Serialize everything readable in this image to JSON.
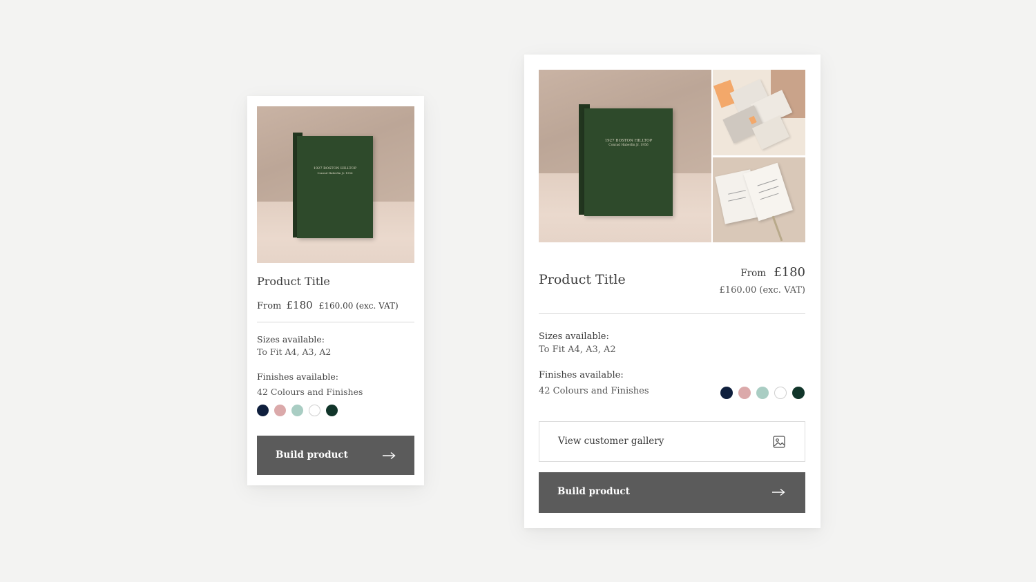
{
  "cards": {
    "small": {
      "title": "Product Title",
      "price_prefix": "From",
      "price": "£180",
      "price_ex_vat": "£160.00 (exc. VAT)",
      "sizes_label": "Sizes available:",
      "sizes_value": "To Fit A4,  A3, A2",
      "finishes_label": "Finishes available:",
      "finishes_value": "42 Colours and Finishes",
      "build_button": "Build product",
      "binder_line1": "1927 BOSTON HILLTOP",
      "binder_line2": "Conrad Haberlin Jr. 1956"
    },
    "large": {
      "title": "Product Title",
      "price_prefix": "From",
      "price": "£180",
      "price_ex_vat": "£160.00 (exc. VAT)",
      "sizes_label": "Sizes available:",
      "sizes_value": "To Fit A4,  A3, A2",
      "finishes_label": "Finishes available:",
      "finishes_value": "42 Colours and Finishes",
      "gallery_button": "View customer gallery",
      "build_button": "Build product",
      "binder_line1": "1927 BOSTON HILLTOP",
      "binder_line2": "Conrad Haberlin Jr. 1956"
    }
  },
  "swatches": [
    {
      "name": "navy",
      "color": "#0f1f3d"
    },
    {
      "name": "blush",
      "color": "#dba9aa"
    },
    {
      "name": "sage",
      "color": "#a9cdc3"
    },
    {
      "name": "white",
      "color": "#ffffff"
    },
    {
      "name": "forest",
      "color": "#11352a"
    }
  ],
  "colors": {
    "background": "#f3f3f2",
    "button": "#5b5b5b",
    "text": "#3a3a3a"
  },
  "icons": {
    "arrow": "arrow-right-icon",
    "gallery": "image-icon"
  }
}
